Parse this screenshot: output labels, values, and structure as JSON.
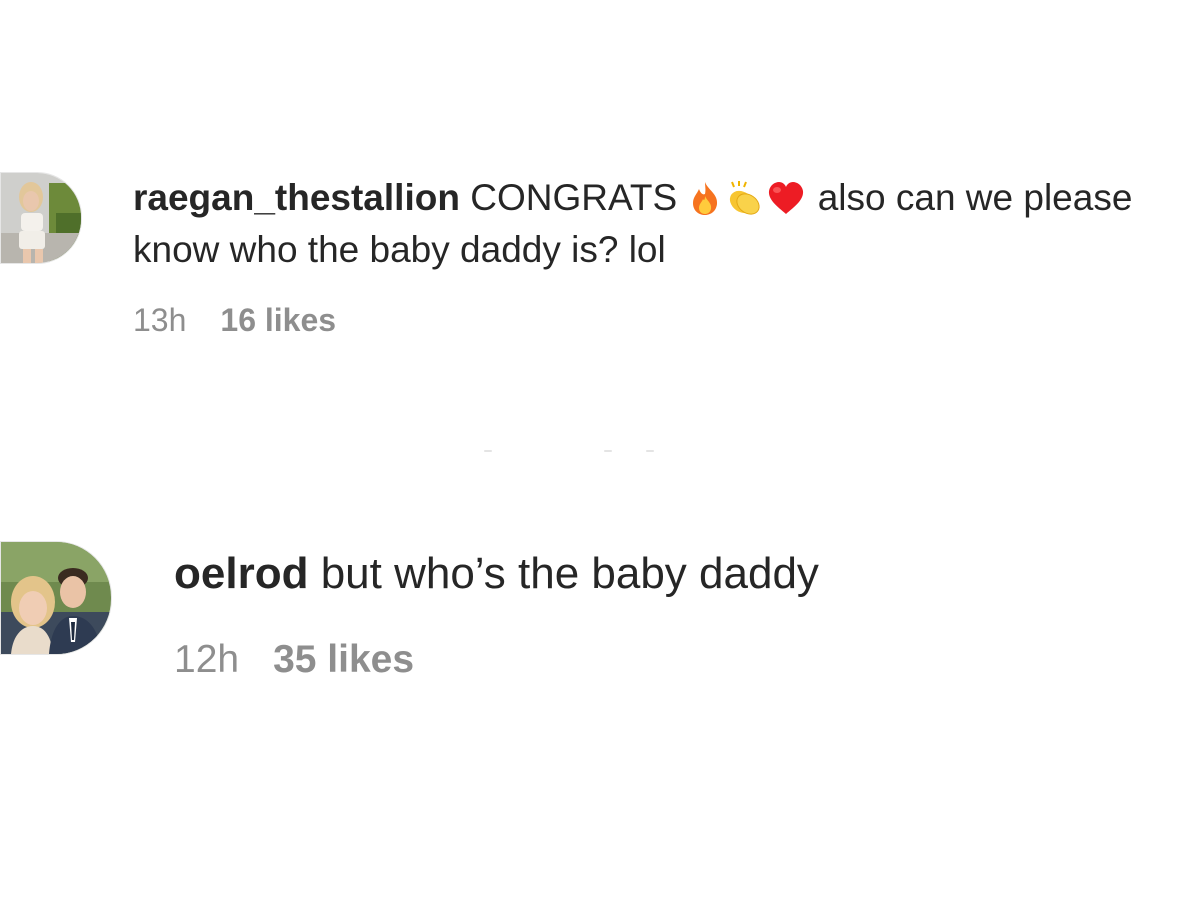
{
  "comments": [
    {
      "username": "raegan_thestallion",
      "text_before_emoji": "CONGRATS",
      "emojis": [
        "fire-emoji",
        "clapping-hands-emoji",
        "red-heart-emoji"
      ],
      "text_after_emoji": "also can we please",
      "text_line2": "know who the baby daddy is? lol",
      "time": "13h",
      "likes": "16 likes",
      "avatar_icon": "profile-photo-woman"
    },
    {
      "username": "oelrod",
      "text": "but who’s the baby daddy",
      "time": "12h",
      "likes": "35 likes",
      "avatar_icon": "profile-photo-couple"
    }
  ],
  "colors": {
    "text_primary": "#262626",
    "text_secondary": "#8e8e8e",
    "background": "#ffffff"
  }
}
